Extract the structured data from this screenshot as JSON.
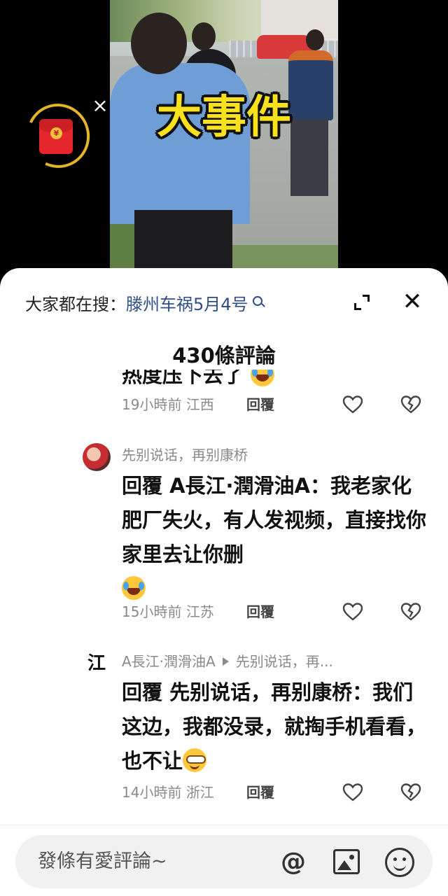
{
  "video": {
    "overlay_title": "大事件"
  },
  "red_packet": {
    "coin_symbol": "¥",
    "close_symbol": "×"
  },
  "sheet": {
    "search_prefix": "大家都在搜：",
    "search_term": "滕州车祸5月4号",
    "close_symbol": "✕",
    "title": "430條評論"
  },
  "comments": [
    {
      "partial_text": "热度压下去了",
      "time": "19小時前",
      "location": "江西",
      "reply_label": "回覆"
    },
    {
      "username": "先别说话，再别康桥",
      "text": "回覆 A長江·潤滑油A：我老家化肥厂失火，有人发视频，直接找你家里去让你删",
      "emoji": "laugh-cry-emoji",
      "time": "15小時前",
      "location": "江苏",
      "reply_label": "回覆"
    },
    {
      "avatar_char": "江",
      "username": "A長江·潤滑油A",
      "reply_to": "先别说话，再...",
      "text": "回覆 先别说话，再别康桥：我们这边，我都没录，就掏手机看看，也不让",
      "emoji": "smirk-emoji",
      "time": "14小時前",
      "location": "浙江",
      "reply_label": "回覆"
    }
  ],
  "input": {
    "placeholder": "發條有愛評論~",
    "at_symbol": "@"
  },
  "colors": {
    "link": "#2f4f86",
    "overlay_title": "#f9e11c",
    "red_packet": "#e5262d"
  }
}
